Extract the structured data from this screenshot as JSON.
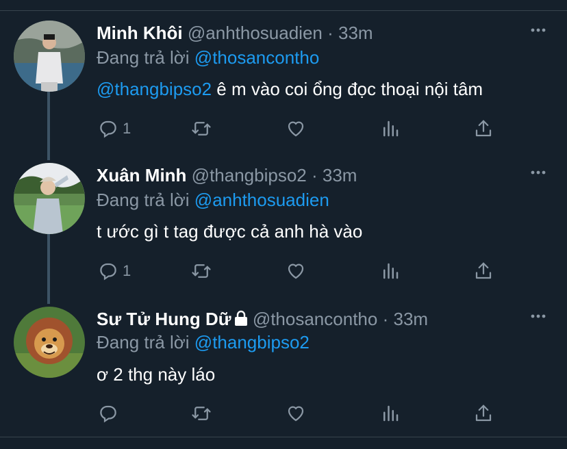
{
  "tweets": [
    {
      "name": "Minh Khôi",
      "handle": "@anhthosuadien",
      "dot": "·",
      "time": "33m",
      "replying_prefix": "Đang trả lời",
      "replying_to": "@thosancontho",
      "body_mention": "@thangbipso2",
      "body_text": " ê m vào coi ổng đọc thoại nội tâm",
      "reply_count": "1",
      "retweet_count": "",
      "like_count": "",
      "locked": false
    },
    {
      "name": "Xuân Minh",
      "handle": "@thangbipso2",
      "dot": "·",
      "time": "33m",
      "replying_prefix": "Đang trả lời",
      "replying_to": "@anhthosuadien",
      "body_mention": "",
      "body_text": "t ước gì t tag được cả anh hà vào",
      "reply_count": "1",
      "retweet_count": "",
      "like_count": "",
      "locked": false
    },
    {
      "name": "Sư Tử Hung Dữ",
      "handle": "@thosancontho",
      "dot": "·",
      "time": "33m",
      "replying_prefix": "Đang trả lời",
      "replying_to": "@thangbipso2",
      "body_mention": "",
      "body_text": "ơ 2 thg này láo",
      "reply_count": "",
      "retweet_count": "",
      "like_count": "",
      "locked": true
    }
  ],
  "colors": {
    "background": "#15202b",
    "secondary_text": "#8b98a5",
    "link": "#1d9bf0",
    "thread_line": "#3d5466",
    "divider": "#38444d"
  },
  "icons": [
    "more-icon",
    "reply-icon",
    "retweet-icon",
    "like-icon",
    "analytics-icon",
    "share-icon",
    "lock-icon"
  ]
}
